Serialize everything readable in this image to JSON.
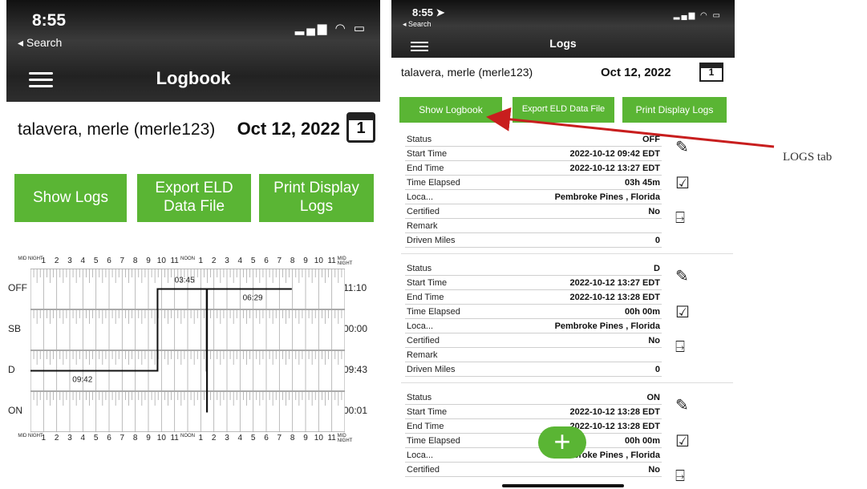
{
  "left": {
    "status_time": "8:55",
    "back_label": "◂ Search",
    "status_icons": "▂▄▆ ◠ ▭",
    "title": "Logbook",
    "driver": "talavera, merle (merle123)",
    "date": "Oct 12, 2022",
    "calendar_day": "1",
    "buttons": [
      "Show Logs",
      "Export ELD Data File",
      "Print Display Logs"
    ],
    "graph": {
      "hour_labels": [
        "MID NIGHT",
        "1",
        "2",
        "3",
        "4",
        "5",
        "6",
        "7",
        "8",
        "9",
        "10",
        "11",
        "NOON",
        "1",
        "2",
        "3",
        "4",
        "5",
        "6",
        "7",
        "8",
        "9",
        "10",
        "11",
        "MID NIGHT"
      ],
      "statuses": [
        "OFF",
        "SB",
        "D",
        "ON"
      ],
      "totals": [
        "11:10",
        "00:00",
        "09:43",
        "00:01"
      ],
      "segment_labels": [
        "03:45",
        "06:29",
        "09:42"
      ],
      "segments": [
        {
          "status": "D",
          "start": 0.0,
          "end": 9.7
        },
        {
          "status": "OFF",
          "start": 9.7,
          "end": 13.45
        },
        {
          "status": "D",
          "start": 13.45,
          "end": 13.47
        },
        {
          "status": "ON",
          "start": 13.47,
          "end": 13.48
        },
        {
          "status": "OFF",
          "start": 13.48,
          "end": 19.95
        }
      ]
    }
  },
  "right": {
    "status_time": "8:55 ➤",
    "back_label": "◂ Search",
    "status_icons": "▂▄▆ ◠ ▭",
    "title": "Logs",
    "driver": "talavera, merle (merle123)",
    "date": "Oct 12, 2022",
    "calendar_day": "1",
    "buttons": [
      "Show Logbook",
      "Export ELD Data File",
      "Print Display Logs"
    ],
    "entries": [
      {
        "Status": "OFF",
        "Start Time": "2022-10-12 09:42 EDT",
        "End Time": "2022-10-12 13:27 EDT",
        "Time Elapsed": "03h 45m",
        "Loca...": "Pembroke Pines , Florida",
        "Certified": "No",
        "Remark": "",
        "Driven Miles": "0"
      },
      {
        "Status": "D",
        "Start Time": "2022-10-12 13:27 EDT",
        "End Time": "2022-10-12 13:28 EDT",
        "Time Elapsed": "00h 00m",
        "Loca...": "Pembroke Pines , Florida",
        "Certified": "No",
        "Remark": "",
        "Driven Miles": "0"
      },
      {
        "Status": "ON",
        "Start Time": "2022-10-12 13:28 EDT",
        "End Time": "2022-10-12 13:28 EDT",
        "Time Elapsed": "00h 00m",
        "Loca...": "Pembroke Pines , Florida",
        "Certified": "No"
      }
    ],
    "entry_icons": [
      "edit-icon",
      "certify-icon",
      "unassign-icon"
    ],
    "fab_label": "+"
  },
  "annotation": {
    "text": "LOGS tab",
    "arrow_color": "#c81e1e"
  },
  "colors": {
    "accent": "#5ab534"
  }
}
